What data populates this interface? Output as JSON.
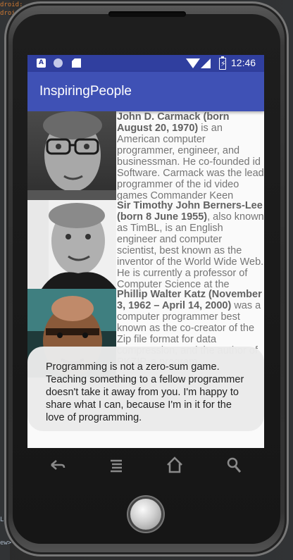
{
  "status_bar": {
    "time": "12:46",
    "notification_a": "A"
  },
  "app_title": "InspiringPeople",
  "people": [
    {
      "name": "John D. Carmack (born August 20, 1970)",
      "bio": " is an American computer programmer, engineer, and businessman. He co-founded id Software. Carmack was the lead programmer of the id video games Commander Keen"
    },
    {
      "name": "Sir Timothy John Berners-Lee (born 8 June 1955)",
      "bio": ", also known as TimBL, is an English engineer and computer scientist, best known as the inventor of the World Wide Web. He is currently a professor of Computer Science at the"
    },
    {
      "name": "Phillip Walter Katz (November 3, 1962 – April 14, 2000)",
      "bio": " was a computer programmer best known as the co-creator of the Zip file format for data compression, and the author of PKZIP, a program"
    }
  ],
  "toast": {
    "message": "Programming is not a zero-sum game. Teaching something to a fellow programmer doesn't take it away from you. I'm happy to share what I can, because I'm in it for the love of programming."
  },
  "ide": {
    "lines": [
      "droid:",
      "droid:",
      "",
      "",
      "",
      "",
      "",
      "",
      "",
      "",
      "",
      "",
      "",
      "",
      "",
      "",
      "",
      "",
      "",
      "",
      "",
      "",
      "",
      "",
      "",
      "",
      "",
      "",
      "",
      "",
      "",
      "",
      "",
      "",
      "",
      "",
      "",
      "",
      "",
      "",
      "",
      "",
      "",
      "",
      "",
      "",
      "",
      "",
      "",
      "",
      "La",
      "",
      "ew>"
    ]
  }
}
